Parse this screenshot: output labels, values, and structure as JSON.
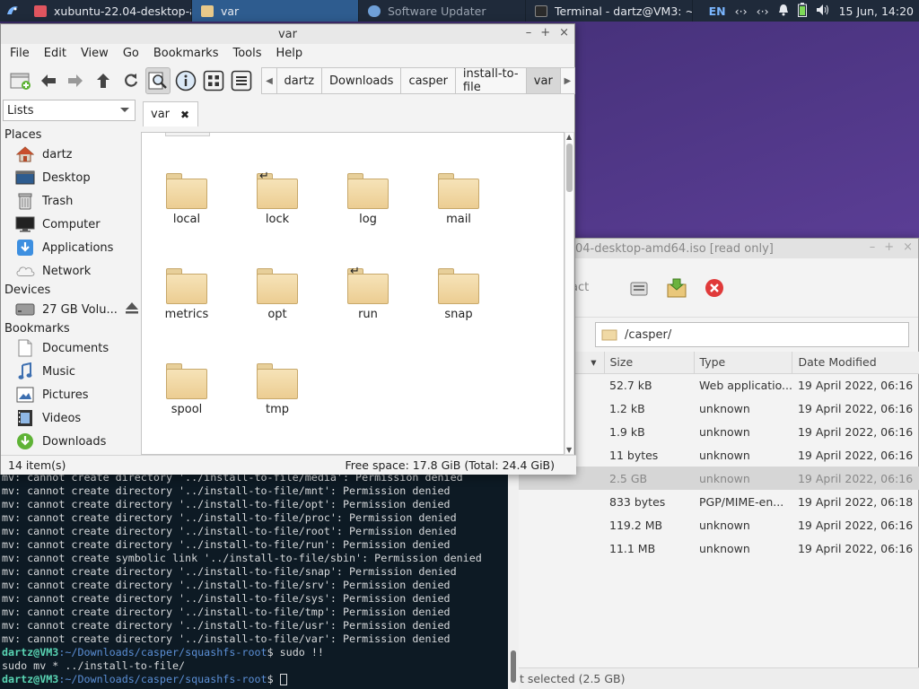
{
  "panel": {
    "tasks": [
      {
        "label": "xubuntu-22.04-desktop-a...",
        "icon": "archive-icon",
        "color": "#e0555f"
      },
      {
        "label": "var",
        "icon": "folder-icon",
        "color": "#e8c98a",
        "active": true
      },
      {
        "label": "Software Updater",
        "icon": "updater-icon",
        "color": "#6fa0d8"
      },
      {
        "label": "Terminal - dartz@VM3: ~/...",
        "icon": "terminal-icon",
        "color": "#2b2b2b"
      }
    ],
    "lang": "EN",
    "datetime": "15 Jun, 14:20"
  },
  "roller": {
    "title": "04-desktop-amd64.iso [read only]",
    "extract_label": "act",
    "location": "/casper/",
    "columns": [
      "Size",
      "Type",
      "Date Modified"
    ],
    "rows": [
      {
        "name": "",
        "size": "52.7 kB",
        "type": "Web applicatio...",
        "date": "19 April 2022, 06:16"
      },
      {
        "name": "ove",
        "size": "1.2 kB",
        "type": "unknown",
        "date": "19 April 2022, 06:16"
      },
      {
        "name": "",
        "size": "1.9 kB",
        "type": "unknown",
        "date": "19 April 2022, 06:16"
      },
      {
        "name": "",
        "size": "11 bytes",
        "type": "unknown",
        "date": "19 April 2022, 06:16"
      },
      {
        "name": "",
        "size": "2.5 GB",
        "type": "unknown",
        "date": "19 April 2022, 06:16",
        "selected": true
      },
      {
        "name": "g",
        "size": "833 bytes",
        "type": "PGP/MIME-en...",
        "date": "19 April 2022, 06:18"
      },
      {
        "name": "",
        "size": "119.2 MB",
        "type": "unknown",
        "date": "19 April 2022, 06:16"
      },
      {
        "name": "",
        "size": "11.1 MB",
        "type": "unknown",
        "date": "19 April 2022, 06:16"
      }
    ],
    "status": "t selected (2.5 GB)"
  },
  "terminal": {
    "lines": [
      "mv: cannot create directory '../install-to-file/media': Permission denied",
      "mv: cannot create directory '../install-to-file/mnt': Permission denied",
      "mv: cannot create directory '../install-to-file/opt': Permission denied",
      "mv: cannot create directory '../install-to-file/proc': Permission denied",
      "mv: cannot create directory '../install-to-file/root': Permission denied",
      "mv: cannot create directory '../install-to-file/run': Permission denied",
      "mv: cannot create symbolic link '../install-to-file/sbin': Permission denied",
      "mv: cannot create directory '../install-to-file/snap': Permission denied",
      "mv: cannot create directory '../install-to-file/srv': Permission denied",
      "mv: cannot create directory '../install-to-file/sys': Permission denied",
      "mv: cannot create directory '../install-to-file/tmp': Permission denied",
      "mv: cannot create directory '../install-to-file/usr': Permission denied",
      "mv: cannot create directory '../install-to-file/var': Permission denied"
    ],
    "prompt_user": "dartz@VM3",
    "prompt_path": ":~/Downloads/casper/squashfs-root",
    "cmd1": "$ sudo !!",
    "echo": "sudo mv * ../install-to-file/",
    "cmd2": "$ "
  },
  "fm": {
    "title": "var",
    "menu": [
      "File",
      "Edit",
      "View",
      "Go",
      "Bookmarks",
      "Tools",
      "Help"
    ],
    "path": [
      "dartz",
      "Downloads",
      "casper",
      "install-to-file",
      "var"
    ],
    "side_combo": "Lists",
    "headers": {
      "places": "Places",
      "devices": "Devices",
      "bookmarks": "Bookmarks"
    },
    "places": [
      {
        "label": "dartz",
        "icon": "home-icon"
      },
      {
        "label": "Desktop",
        "icon": "desktop-icon"
      },
      {
        "label": "Trash",
        "icon": "trash-icon"
      },
      {
        "label": "Computer",
        "icon": "computer-icon"
      },
      {
        "label": "Applications",
        "icon": "applications-icon"
      },
      {
        "label": "Network",
        "icon": "network-icon"
      }
    ],
    "devices": [
      {
        "label": "27 GB Volu...",
        "icon": "drive-icon"
      }
    ],
    "bookmarks": [
      {
        "label": "Documents",
        "icon": "documents-icon"
      },
      {
        "label": "Music",
        "icon": "music-icon"
      },
      {
        "label": "Pictures",
        "icon": "pictures-icon"
      },
      {
        "label": "Videos",
        "icon": "videos-icon"
      },
      {
        "label": "Downloads",
        "icon": "downloads-icon"
      }
    ],
    "tab_label": "var",
    "folders": [
      {
        "name": "local",
        "link": false
      },
      {
        "name": "lock",
        "link": true
      },
      {
        "name": "log",
        "link": false
      },
      {
        "name": "mail",
        "link": false
      },
      {
        "name": "metrics",
        "link": false
      },
      {
        "name": "opt",
        "link": false
      },
      {
        "name": "run",
        "link": true
      },
      {
        "name": "snap",
        "link": false
      },
      {
        "name": "spool",
        "link": false
      },
      {
        "name": "tmp",
        "link": false
      }
    ],
    "item_count": "14 item(s)",
    "free_space": "Free space: 17.8 GiB (Total: 24.4 GiB)"
  }
}
